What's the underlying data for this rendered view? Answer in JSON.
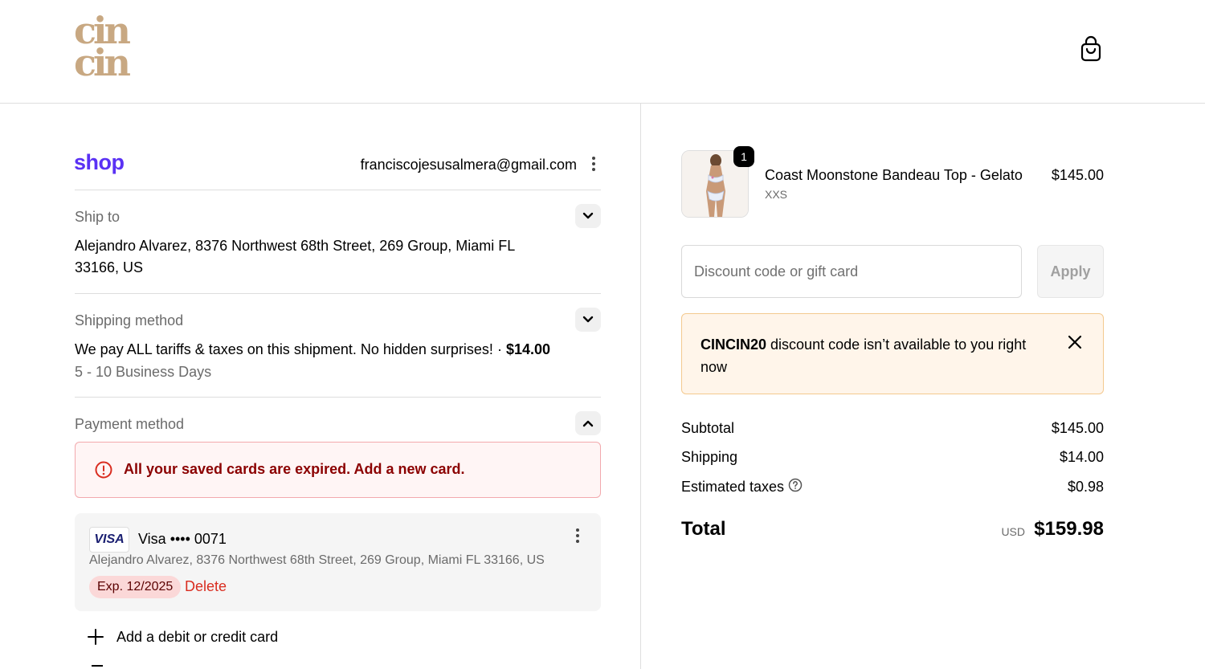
{
  "header": {
    "logo_line1": "cin",
    "logo_line2": "cin",
    "cart_icon": "shopping-bag-icon"
  },
  "account": {
    "shop_brand": "shop",
    "email": "franciscojesusalmera@gmail.com",
    "more_icon": "kebab-menu-icon"
  },
  "ship_to": {
    "label": "Ship to",
    "address_line1": "Alejandro Alvarez, 8376 Northwest 68th Street, 269 Group, Miami FL",
    "address_line2": "33166, US"
  },
  "shipping_method": {
    "label": "Shipping method",
    "description": "We pay ALL tariffs & taxes on this shipment. No hidden surprises! · ",
    "price": "$14.00",
    "delivery": "5 - 10 Business Days"
  },
  "payment_method": {
    "label": "Payment method",
    "error": "All your saved cards are expired. Add a new card.",
    "card": {
      "brand": "VISA",
      "name": "Visa •••• 0071",
      "address": "Alejandro Alvarez, 8376 Northwest 68th Street, 269 Group, Miami FL 33166, US",
      "expiry": "Exp. 12/2025",
      "delete_label": "Delete"
    },
    "add_card_label": "Add a debit or credit card"
  },
  "order": {
    "product": {
      "quantity": "1",
      "name": "Coast Moonstone Bandeau Top - Gelato",
      "variant": "XXS",
      "price": "$145.00"
    },
    "discount": {
      "placeholder": "Discount code or gift card",
      "value": "",
      "apply_label": "Apply"
    },
    "warning": {
      "code": "CINCIN20",
      "message": " discount code isn’t available to you right now"
    },
    "summary": {
      "subtotal_label": "Subtotal",
      "subtotal_value": "$145.00",
      "shipping_label": "Shipping",
      "shipping_value": "$14.00",
      "taxes_label": "Estimated taxes",
      "taxes_value": "$0.98",
      "total_label": "Total",
      "total_currency": "USD",
      "total_value": "$159.98"
    }
  },
  "colors": {
    "brand_logo": "#c8a882",
    "shop_purple": "#5a31f4",
    "error_red": "#d92d20",
    "warning_bg": "#fff5ea"
  }
}
